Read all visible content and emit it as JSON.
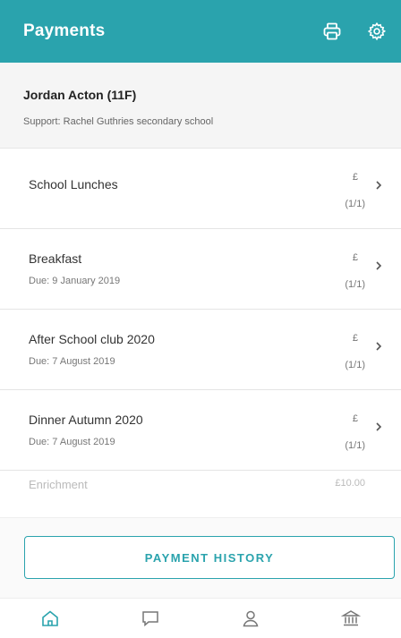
{
  "header": {
    "title": "Payments",
    "icons": [
      "printer-icon",
      "gear-icon"
    ],
    "accent_color": "#2aa3ad"
  },
  "student": {
    "name": "Jordan Acton (11F)",
    "school": "Support: Rachel Guthries secondary school"
  },
  "payments": [
    {
      "label": "School Lunches",
      "due": "",
      "currency": "£",
      "count": "(1/1)"
    },
    {
      "label": "Breakfast",
      "due": "Due: 9 January 2019",
      "currency": "£",
      "count": "(1/1)"
    },
    {
      "label": "After School club 2020",
      "due": "Due: 7 August 2019",
      "currency": "£",
      "count": "(1/1)"
    },
    {
      "label": "Dinner Autumn 2020",
      "due": "Due: 7 August 2019",
      "currency": "£",
      "count": "(1/1)"
    }
  ],
  "partial_item": {
    "label": "Enrichment",
    "amount": "£10.00"
  },
  "history_button": {
    "label": "PAYMENT HISTORY"
  },
  "bottom_nav": [
    {
      "icon": "home-icon",
      "active": true
    },
    {
      "icon": "chat-icon",
      "active": false
    },
    {
      "icon": "user-icon",
      "active": false
    },
    {
      "icon": "bank-icon",
      "active": false
    }
  ]
}
